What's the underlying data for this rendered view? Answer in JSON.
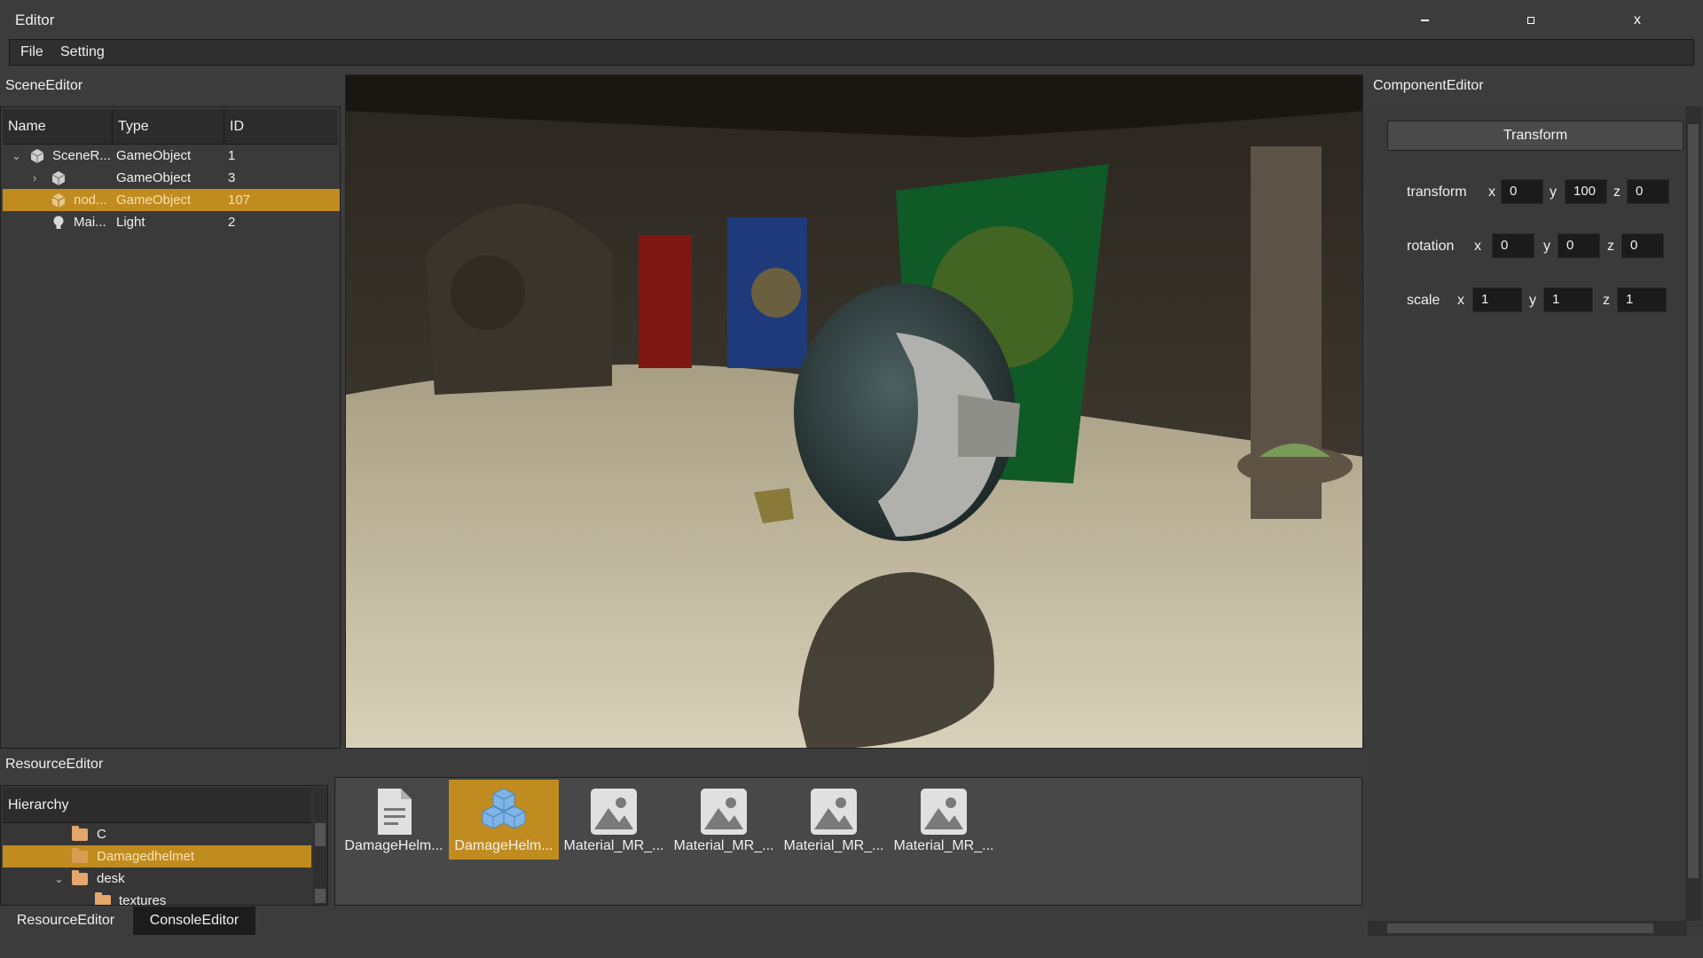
{
  "window": {
    "title": "Editor",
    "minimize_icon": "minimize-icon",
    "maximize_icon": "maximize-icon",
    "close_label": "x"
  },
  "menu": {
    "file": "File",
    "setting": "Setting"
  },
  "scene_editor": {
    "title": "SceneEditor",
    "columns": [
      "Name",
      "Type",
      "ID"
    ],
    "rows": [
      {
        "name": "SceneR...",
        "type": "GameObject",
        "id": "1",
        "icon": "cube-icon",
        "selected": false
      },
      {
        "name": "",
        "type": "GameObject",
        "id": "3",
        "icon": "cube-icon",
        "selected": false
      },
      {
        "name": "nod...",
        "type": "GameObject",
        "id": "107",
        "icon": "cube-icon",
        "selected": true
      },
      {
        "name": "Mai...",
        "type": "Light",
        "id": "2",
        "icon": "lightbulb-icon",
        "selected": false
      }
    ]
  },
  "component_editor": {
    "title": "ComponentEditor",
    "component_button": "Transform",
    "properties": [
      {
        "label": "transform",
        "x": "0",
        "y": "100",
        "z": "0"
      },
      {
        "label": "rotation",
        "x": "0",
        "y": "0",
        "z": "0"
      },
      {
        "label": "scale",
        "x": "1",
        "y": "1",
        "z": "1"
      }
    ],
    "axis_labels": {
      "x": "x",
      "y": "y",
      "z": "z"
    }
  },
  "resource_editor": {
    "title": "ResourceEditor",
    "hierarchy_header": "Hierarchy",
    "tree": [
      {
        "label": "C",
        "selected": false
      },
      {
        "label": "Damagedhelmet",
        "selected": true
      },
      {
        "label": "desk",
        "selected": false
      },
      {
        "label": "textures",
        "selected": false
      }
    ],
    "files": [
      {
        "label": "DamageHelm...",
        "icon": "document-icon",
        "selected": false
      },
      {
        "label": "DamageHelm...",
        "icon": "model-cubes-icon",
        "selected": true
      },
      {
        "label": "Material_MR_...",
        "icon": "image-icon",
        "selected": false
      },
      {
        "label": "Material_MR_...",
        "icon": "image-icon",
        "selected": false
      },
      {
        "label": "Material_MR_...",
        "icon": "image-icon",
        "selected": false
      },
      {
        "label": "Material_MR_...",
        "icon": "image-icon",
        "selected": false
      }
    ]
  },
  "bottom_tabs": {
    "resource": "ResourceEditor",
    "console": "ConsoleEditor"
  },
  "colors": {
    "selection": "#c18c1f",
    "background": "#3c3c3c",
    "panel": "#3a3a3a",
    "field": "#1b1b1b"
  }
}
